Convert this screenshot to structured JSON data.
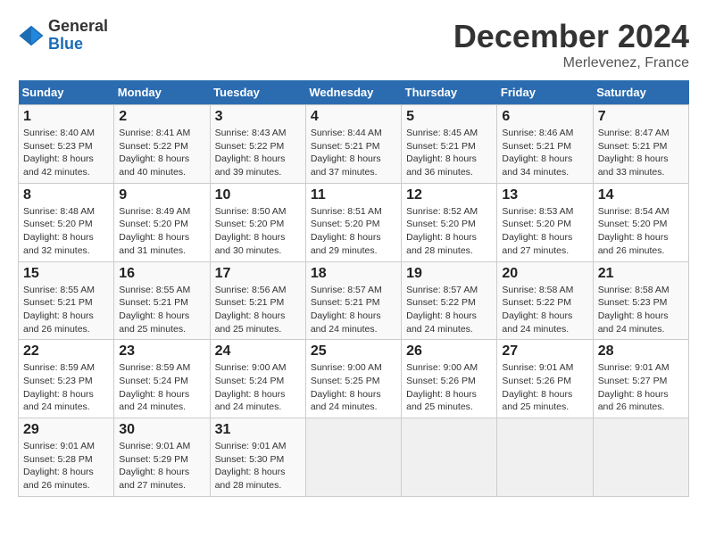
{
  "logo": {
    "general": "General",
    "blue": "Blue"
  },
  "header": {
    "month": "December 2024",
    "location": "Merlevenez, France"
  },
  "weekdays": [
    "Sunday",
    "Monday",
    "Tuesday",
    "Wednesday",
    "Thursday",
    "Friday",
    "Saturday"
  ],
  "weeks": [
    [
      {
        "day": "1",
        "sunrise": "Sunrise: 8:40 AM",
        "sunset": "Sunset: 5:23 PM",
        "daylight": "Daylight: 8 hours and 42 minutes."
      },
      {
        "day": "2",
        "sunrise": "Sunrise: 8:41 AM",
        "sunset": "Sunset: 5:22 PM",
        "daylight": "Daylight: 8 hours and 40 minutes."
      },
      {
        "day": "3",
        "sunrise": "Sunrise: 8:43 AM",
        "sunset": "Sunset: 5:22 PM",
        "daylight": "Daylight: 8 hours and 39 minutes."
      },
      {
        "day": "4",
        "sunrise": "Sunrise: 8:44 AM",
        "sunset": "Sunset: 5:21 PM",
        "daylight": "Daylight: 8 hours and 37 minutes."
      },
      {
        "day": "5",
        "sunrise": "Sunrise: 8:45 AM",
        "sunset": "Sunset: 5:21 PM",
        "daylight": "Daylight: 8 hours and 36 minutes."
      },
      {
        "day": "6",
        "sunrise": "Sunrise: 8:46 AM",
        "sunset": "Sunset: 5:21 PM",
        "daylight": "Daylight: 8 hours and 34 minutes."
      },
      {
        "day": "7",
        "sunrise": "Sunrise: 8:47 AM",
        "sunset": "Sunset: 5:21 PM",
        "daylight": "Daylight: 8 hours and 33 minutes."
      }
    ],
    [
      {
        "day": "8",
        "sunrise": "Sunrise: 8:48 AM",
        "sunset": "Sunset: 5:20 PM",
        "daylight": "Daylight: 8 hours and 32 minutes."
      },
      {
        "day": "9",
        "sunrise": "Sunrise: 8:49 AM",
        "sunset": "Sunset: 5:20 PM",
        "daylight": "Daylight: 8 hours and 31 minutes."
      },
      {
        "day": "10",
        "sunrise": "Sunrise: 8:50 AM",
        "sunset": "Sunset: 5:20 PM",
        "daylight": "Daylight: 8 hours and 30 minutes."
      },
      {
        "day": "11",
        "sunrise": "Sunrise: 8:51 AM",
        "sunset": "Sunset: 5:20 PM",
        "daylight": "Daylight: 8 hours and 29 minutes."
      },
      {
        "day": "12",
        "sunrise": "Sunrise: 8:52 AM",
        "sunset": "Sunset: 5:20 PM",
        "daylight": "Daylight: 8 hours and 28 minutes."
      },
      {
        "day": "13",
        "sunrise": "Sunrise: 8:53 AM",
        "sunset": "Sunset: 5:20 PM",
        "daylight": "Daylight: 8 hours and 27 minutes."
      },
      {
        "day": "14",
        "sunrise": "Sunrise: 8:54 AM",
        "sunset": "Sunset: 5:20 PM",
        "daylight": "Daylight: 8 hours and 26 minutes."
      }
    ],
    [
      {
        "day": "15",
        "sunrise": "Sunrise: 8:55 AM",
        "sunset": "Sunset: 5:21 PM",
        "daylight": "Daylight: 8 hours and 26 minutes."
      },
      {
        "day": "16",
        "sunrise": "Sunrise: 8:55 AM",
        "sunset": "Sunset: 5:21 PM",
        "daylight": "Daylight: 8 hours and 25 minutes."
      },
      {
        "day": "17",
        "sunrise": "Sunrise: 8:56 AM",
        "sunset": "Sunset: 5:21 PM",
        "daylight": "Daylight: 8 hours and 25 minutes."
      },
      {
        "day": "18",
        "sunrise": "Sunrise: 8:57 AM",
        "sunset": "Sunset: 5:21 PM",
        "daylight": "Daylight: 8 hours and 24 minutes."
      },
      {
        "day": "19",
        "sunrise": "Sunrise: 8:57 AM",
        "sunset": "Sunset: 5:22 PM",
        "daylight": "Daylight: 8 hours and 24 minutes."
      },
      {
        "day": "20",
        "sunrise": "Sunrise: 8:58 AM",
        "sunset": "Sunset: 5:22 PM",
        "daylight": "Daylight: 8 hours and 24 minutes."
      },
      {
        "day": "21",
        "sunrise": "Sunrise: 8:58 AM",
        "sunset": "Sunset: 5:23 PM",
        "daylight": "Daylight: 8 hours and 24 minutes."
      }
    ],
    [
      {
        "day": "22",
        "sunrise": "Sunrise: 8:59 AM",
        "sunset": "Sunset: 5:23 PM",
        "daylight": "Daylight: 8 hours and 24 minutes."
      },
      {
        "day": "23",
        "sunrise": "Sunrise: 8:59 AM",
        "sunset": "Sunset: 5:24 PM",
        "daylight": "Daylight: 8 hours and 24 minutes."
      },
      {
        "day": "24",
        "sunrise": "Sunrise: 9:00 AM",
        "sunset": "Sunset: 5:24 PM",
        "daylight": "Daylight: 8 hours and 24 minutes."
      },
      {
        "day": "25",
        "sunrise": "Sunrise: 9:00 AM",
        "sunset": "Sunset: 5:25 PM",
        "daylight": "Daylight: 8 hours and 24 minutes."
      },
      {
        "day": "26",
        "sunrise": "Sunrise: 9:00 AM",
        "sunset": "Sunset: 5:26 PM",
        "daylight": "Daylight: 8 hours and 25 minutes."
      },
      {
        "day": "27",
        "sunrise": "Sunrise: 9:01 AM",
        "sunset": "Sunset: 5:26 PM",
        "daylight": "Daylight: 8 hours and 25 minutes."
      },
      {
        "day": "28",
        "sunrise": "Sunrise: 9:01 AM",
        "sunset": "Sunset: 5:27 PM",
        "daylight": "Daylight: 8 hours and 26 minutes."
      }
    ],
    [
      {
        "day": "29",
        "sunrise": "Sunrise: 9:01 AM",
        "sunset": "Sunset: 5:28 PM",
        "daylight": "Daylight: 8 hours and 26 minutes."
      },
      {
        "day": "30",
        "sunrise": "Sunrise: 9:01 AM",
        "sunset": "Sunset: 5:29 PM",
        "daylight": "Daylight: 8 hours and 27 minutes."
      },
      {
        "day": "31",
        "sunrise": "Sunrise: 9:01 AM",
        "sunset": "Sunset: 5:30 PM",
        "daylight": "Daylight: 8 hours and 28 minutes."
      },
      null,
      null,
      null,
      null
    ]
  ]
}
